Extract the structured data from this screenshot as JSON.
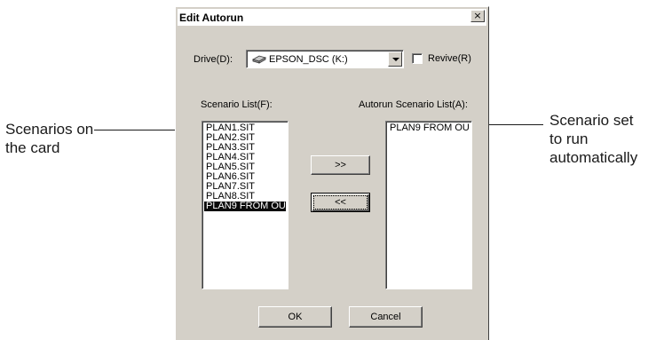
{
  "callouts": {
    "left": [
      "Scenarios on",
      "the card"
    ],
    "right": [
      "Scenario set",
      "to run",
      "automatically"
    ]
  },
  "dialog": {
    "title": "Edit Autorun",
    "close_glyph": "×",
    "drive_label": "Drive(D):",
    "drive_value": "EPSON_DSC (K:)",
    "drive_icon": "drive-icon",
    "revive_label": "Revive(R)",
    "revive_checked": false,
    "scenario_list_label": "Scenario List(F):",
    "autorun_list_label": "Autorun Scenario List(A):",
    "scenario_items": [
      "PLAN1.SIT",
      "PLAN2.SIT",
      "PLAN3.SIT",
      "PLAN4.SIT",
      "PLAN5.SIT",
      "PLAN6.SIT",
      "PLAN7.SIT",
      "PLAN8.SIT",
      "PLAN9 FROM OU"
    ],
    "scenario_selected": "PLAN9 FROM OU",
    "autorun_items": [
      "PLAN9 FROM OU"
    ],
    "add_label": ">>",
    "remove_label": "<<",
    "ok_label": "OK",
    "cancel_label": "Cancel"
  }
}
